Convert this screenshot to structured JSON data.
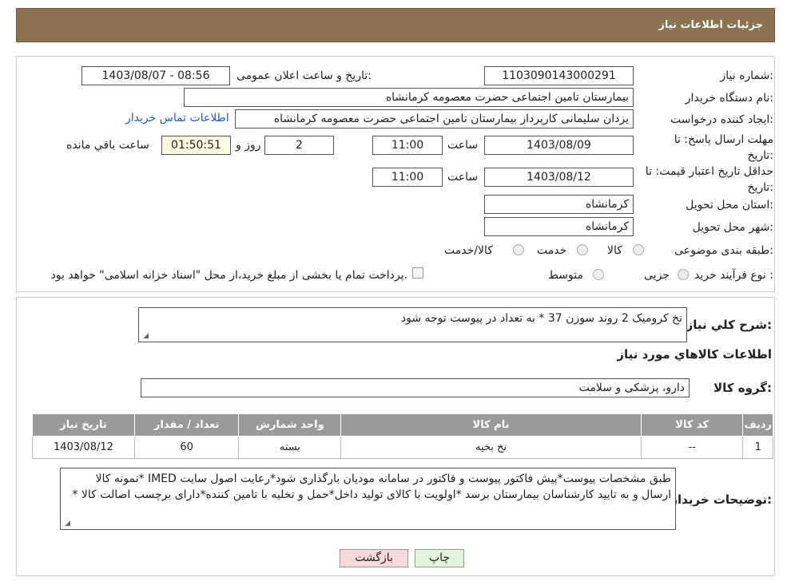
{
  "header": {
    "title": "جزئیات اطلاعات نیاز"
  },
  "fields": {
    "need_number_label": "شماره نیاز:",
    "need_number": "1103090143000291",
    "announce_label": "تاریخ و ساعت اعلان عمومی:",
    "announce_value": "1403/08/07 - 08:56",
    "buyer_org_label": "نام دستگاه خریدار:",
    "buyer_org": "بیمارستان تامین اجتماعی حضرت معصومه کرمانشاه",
    "creator_label": "ایجاد کننده درخواست:",
    "creator": "یزدان  سلیمانی کارپرداز بیمارستان تامین اجتماعی حضرت معصومه کرمانشاه",
    "contact_link": "اطلاعات تماس خریدار",
    "deadline_label": "مهلت ارسال پاسخ: تا تاریخ:",
    "deadline_date": "1403/08/09",
    "time_label": "ساعت",
    "deadline_time": "11:00",
    "days": "2",
    "days_label": "روز و",
    "remaining_time": "01:50:51",
    "remaining_label": "ساعت باقي مانده",
    "validity_label": "حداقل تاریخ اعتبار قیمت: تا تاریخ:",
    "validity_date": "1403/08/12",
    "validity_time": "11:00",
    "province_label": "استان محل تحویل:",
    "province": "کرمانشاه",
    "city_label": "شهر محل تحویل:",
    "city": "کرمانشاه",
    "category_label": "طبقه بندی موضوعی:",
    "category_options": [
      "کالا",
      "خدمت",
      "کالا/خدمت"
    ],
    "purchase_type_label": "نوع فرآیند خرید :",
    "purchase_options": [
      "جزیی",
      "متوسط"
    ],
    "purchase_note": "پرداخت تمام یا بخشی از مبلغ خرید،از محل \"اسناد خزانه اسلامی\" خواهد بود."
  },
  "details": {
    "summary_label": "شرح کلي نياز:",
    "summary": "نخ کرومیک 2 روند سوزن 37 * به تعداد در پیوست توجه شود",
    "goods_info_title": "اطلاعات کالاهاي مورد نياز",
    "group_label": "گروه کالا:",
    "group_value": "دارو، پزشکی و سلامت"
  },
  "table": {
    "headers": [
      "رديف",
      "کد کالا",
      "نام کالا",
      "واحد شمارش",
      "تعداد / مقدار",
      "تاریخ نیاز"
    ],
    "rows": [
      [
        "1",
        "--",
        "نخ بخیه",
        "بسته",
        "60",
        "1403/08/12"
      ]
    ]
  },
  "buyer_notes": {
    "label": "توضیحات خریدار:",
    "text": "طبق مشخصات پیوست*پیش فاکتور پیوست و فاکتور در سامانه مودیان بارگذاری شود*رعایت اصول سایت IMED *نمونه کالا ارسال و به تایید کارشناسان بیمارستان برسد *اولویت با کالای تولید داخل*حمل و تخلیه با تامین کننده*دارای برچسب اصالت کالا *"
  },
  "buttons": {
    "print": "چاپ",
    "back": "بازگشت"
  },
  "colors": {
    "header_bg": "#8b7250",
    "table_header_bg": "#9a9a9a",
    "back_btn_bg": "#f7d9dc",
    "print_btn_bg": "#e3f4dc"
  }
}
